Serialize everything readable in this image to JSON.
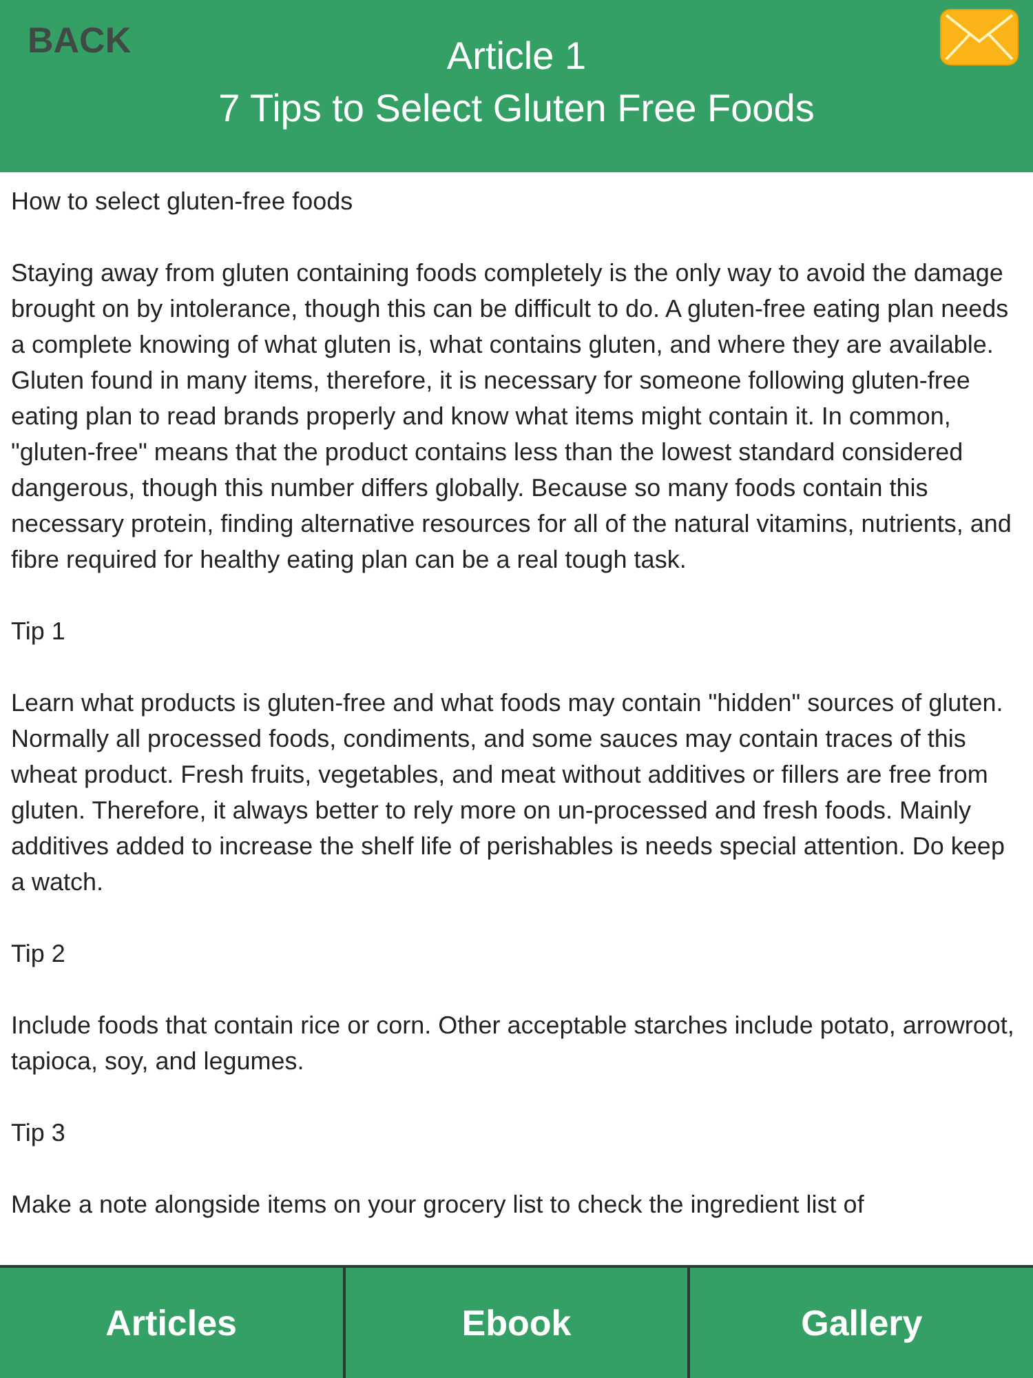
{
  "header": {
    "back": "BACK",
    "title": "Article 1",
    "subtitle": "7 Tips to Select Gluten Free Foods"
  },
  "paragraphs": [
    "How to select gluten-free foods",
    "Staying away from gluten containing foods completely is the only way to avoid the damage brought on by intolerance, though this can be difficult to do. A gluten-free eating plan needs a complete knowing of what gluten is, what contains gluten, and where they are available. Gluten found in many items, therefore, it is necessary for someone following gluten-free eating plan to read brands properly and know what items might contain it. In common, \"gluten-free\" means that the product contains less than the lowest standard considered dangerous, though this number differs globally. Because so many foods contain this necessary protein, finding alternative resources for all of the natural vitamins, nutrients, and fibre required for healthy eating plan can be a real tough task.",
    "Tip 1",
    "Learn what products is gluten-free and what foods may contain \"hidden\" sources of gluten. Normally all processed foods, condiments, and some sauces may contain traces of this wheat product. Fresh fruits, vegetables, and meat without additives or fillers are free from gluten. Therefore, it always better to rely more on un-processed and fresh foods. Mainly additives added to increase the shelf life of perishables is needs special attention. Do keep a watch.",
    "Tip 2",
    "Include foods that contain rice or corn. Other acceptable starches include potato, arrowroot, tapioca, soy, and legumes.",
    "Tip 3",
    "Make a note alongside items on your grocery list to check the ingredient list of"
  ],
  "tabs": [
    {
      "label": "Articles"
    },
    {
      "label": "Ebook"
    },
    {
      "label": "Gallery"
    }
  ]
}
